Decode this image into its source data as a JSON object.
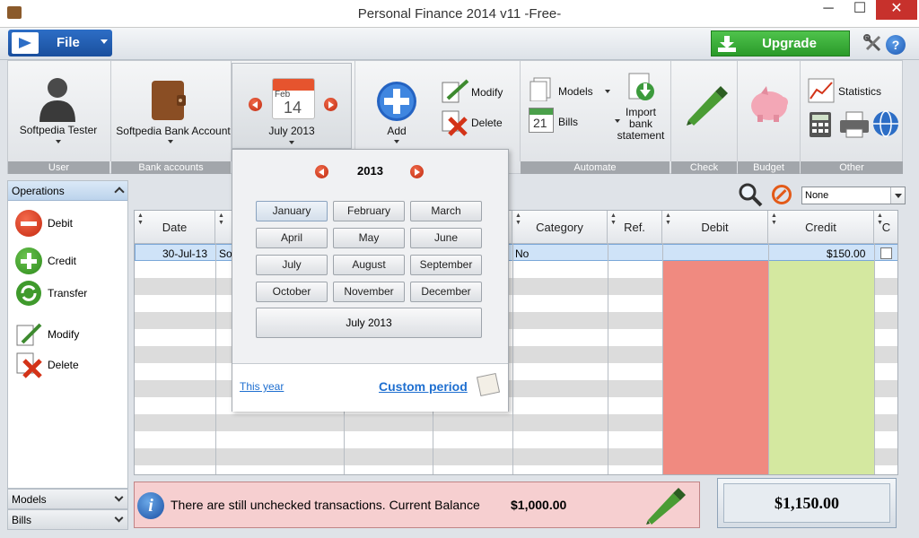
{
  "window": {
    "title": "Personal Finance 2014 v11 -Free-",
    "controls": {
      "minimize": "─",
      "maximize": "☐",
      "close": "✕"
    }
  },
  "menubar": {
    "file_label": "File",
    "upgrade_label": "Upgrade"
  },
  "ribbon": {
    "user": {
      "name": "Softpedia Tester",
      "group": "User"
    },
    "bank": {
      "name": "Softpedia Bank Account",
      "group": "Bank accounts"
    },
    "date": {
      "day_month": "Feb",
      "day_number": "14",
      "label": "July 2013"
    },
    "operations": {
      "add": "Add",
      "modify": "Modify",
      "delete": "Delete"
    },
    "automate": {
      "models": "Models",
      "bills": "Bills",
      "bills_day": "21",
      "import": "Import bank statement",
      "group": "Automate"
    },
    "check": {
      "group": "Check"
    },
    "budget": {
      "group": "Budget"
    },
    "other": {
      "statistics": "Statistics",
      "group": "Other"
    }
  },
  "left_panel": {
    "header": "Operations",
    "items": [
      {
        "label": "Debit"
      },
      {
        "label": "Credit"
      },
      {
        "label": "Transfer"
      },
      {
        "label": "Modify"
      },
      {
        "label": "Delete"
      }
    ],
    "accordions": [
      "Models",
      "Bills"
    ]
  },
  "filter": {
    "selected": "None"
  },
  "grid": {
    "columns": [
      "Date",
      "",
      "",
      "",
      "Category",
      "Ref.",
      "Debit",
      "Credit",
      "C"
    ],
    "rows": [
      {
        "date": "30-Jul-13",
        "desc": "So",
        "category": "No",
        "ref": "",
        "debit": "",
        "credit": "$150.00",
        "checked": false
      }
    ]
  },
  "status": {
    "message": "There are still unchecked transactions. Current Balance",
    "current_balance": "$1,000.00",
    "total_balance": "$1,150.00"
  },
  "calendar_popup": {
    "year": "2013",
    "months": [
      "January",
      "February",
      "March",
      "April",
      "May",
      "June",
      "July",
      "August",
      "September",
      "October",
      "November",
      "December"
    ],
    "active_month": "January",
    "period_button": "July 2013",
    "this_year_link": "This year",
    "custom_period_link": "Custom period"
  },
  "colors": {
    "debit_column": "#f08a80",
    "credit_column": "#d4e8a0",
    "status_background": "#f6cfd0",
    "accent_blue": "#1e6fd0",
    "upgrade_green": "#2a9a2a"
  }
}
